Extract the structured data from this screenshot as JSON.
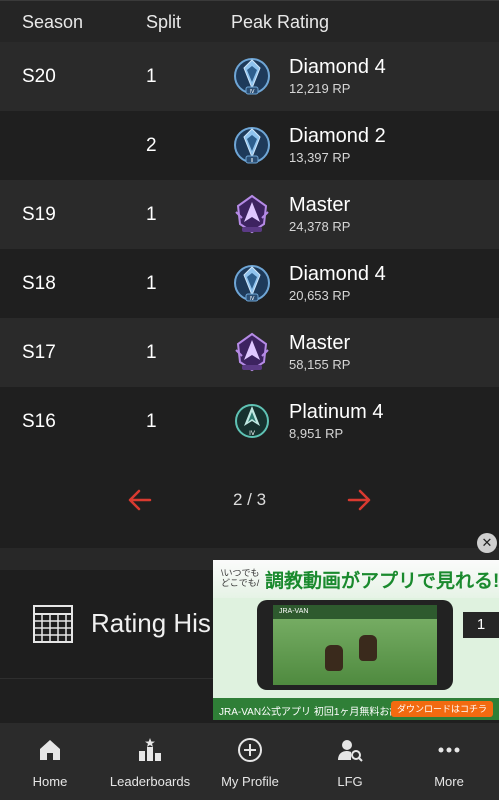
{
  "table": {
    "headers": {
      "season": "Season",
      "split": "Split",
      "peak": "Peak Rating"
    },
    "rows": [
      {
        "season": "S20",
        "split": "1",
        "rank": "Diamond 4",
        "rp": "12,219 RP",
        "badge": "diamond-4"
      },
      {
        "season": "",
        "split": "2",
        "rank": "Diamond 2",
        "rp": "13,397 RP",
        "badge": "diamond-2"
      },
      {
        "season": "S19",
        "split": "1",
        "rank": "Master",
        "rp": "24,378 RP",
        "badge": "master"
      },
      {
        "season": "S18",
        "split": "1",
        "rank": "Diamond 4",
        "rp": "20,653 RP",
        "badge": "diamond-4"
      },
      {
        "season": "S17",
        "split": "1",
        "rank": "Master",
        "rp": "58,155 RP",
        "badge": "master"
      },
      {
        "season": "S16",
        "split": "1",
        "rank": "Platinum 4",
        "rp": "8,951 RP",
        "badge": "platinum-4"
      }
    ]
  },
  "pagination": {
    "indicator": "2 / 3",
    "prev_icon": "arrow-left-icon",
    "next_icon": "arrow-right-icon",
    "arrow_color": "#d93a30"
  },
  "rating_history": {
    "title": "Rating His",
    "icon": "calendar-grid-icon"
  },
  "ad": {
    "tag": "\\いつでも どこでも/",
    "headline": "調教動画がアプリで見れる!",
    "bottom_text": "JRA-VAN公式アプリ 初回1ヶ月無料お試し!",
    "cta": "ダウンロードはコチラ",
    "close": "✕"
  },
  "side_badge": "1",
  "nav": {
    "items": [
      {
        "label": "Home",
        "icon": "home-icon"
      },
      {
        "label": "Leaderboards",
        "icon": "leaderboard-icon"
      },
      {
        "label": "My Profile",
        "icon": "add-circle-icon"
      },
      {
        "label": "LFG",
        "icon": "user-search-icon"
      },
      {
        "label": "More",
        "icon": "more-dots-icon"
      }
    ]
  },
  "colors": {
    "diamond": "#4a7fb0",
    "master": "#7b4fb3",
    "platinum": "#3f9c8f",
    "accent": "#d93a30"
  }
}
